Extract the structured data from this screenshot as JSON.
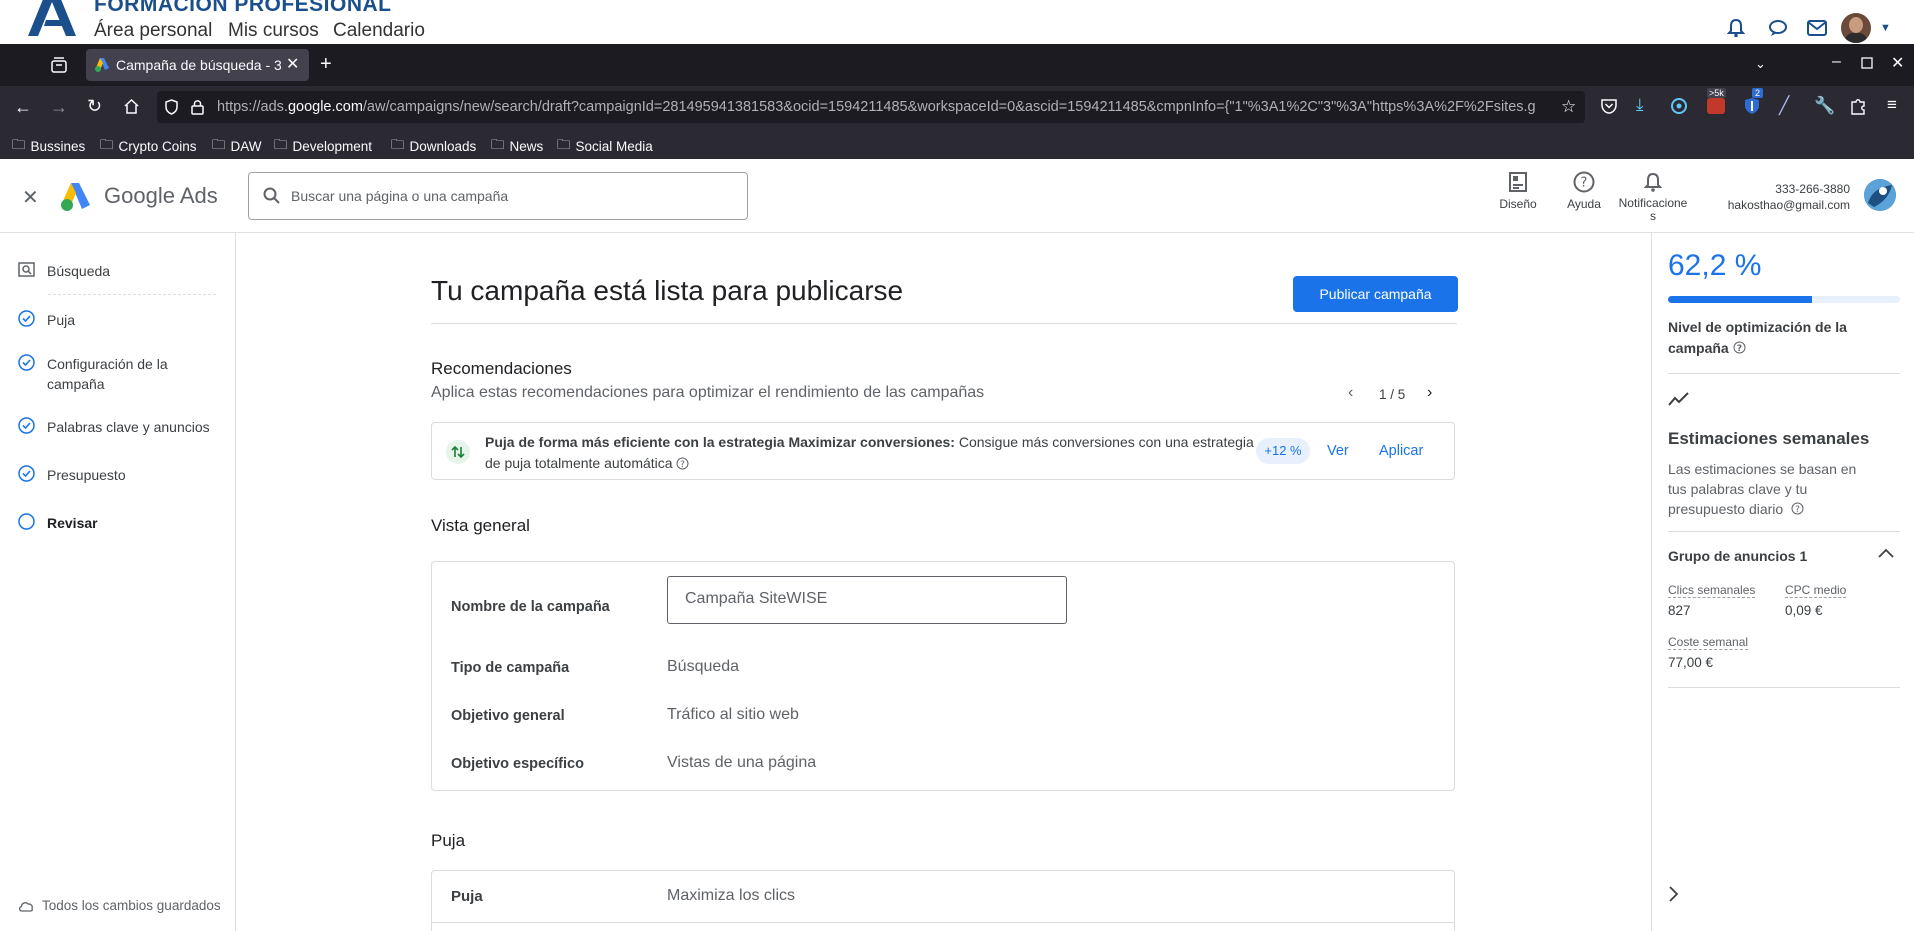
{
  "site": {
    "brand": "FORMACIÓN PROFESIONAL",
    "nav": [
      "Área personal",
      "Mis cursos",
      "Calendario"
    ]
  },
  "browser": {
    "tab_title": "Campaña de búsqueda - 3",
    "url_prefix": "https://ads.",
    "url_domain": "google.com",
    "url_rest": "/aw/campaigns/new/search/draft?campaignId=281495941381583&ocid=1594211485&workspaceId=0&ascid=1594211485&cmpnInfo={\"1\"%3A1%2C\"3\"%3A\"https%3A%2F%2Fsites.g",
    "badge_5k": ">5k",
    "badge_2": "2",
    "bookmarks": [
      "Bussines",
      "Crypto Coins",
      "DAW",
      "Development",
      "Downloads",
      "News",
      "Social Media"
    ]
  },
  "ads_header": {
    "product": "Google Ads",
    "search_placeholder": "Buscar una página o una campaña",
    "buttons": [
      {
        "label": "Diseño",
        "icon": "layout-icon"
      },
      {
        "label": "Ayuda",
        "icon": "help-icon"
      },
      {
        "label": "Notificaciones",
        "icon": "bell-icon"
      }
    ],
    "account_phone": "333-266-3880",
    "account_email": "hakosthao@gmail.com"
  },
  "leftnav": {
    "items": [
      {
        "label": "Búsqueda",
        "state": "search"
      },
      {
        "label": "Puja",
        "state": "done"
      },
      {
        "label": "Configuración de la campaña",
        "state": "done"
      },
      {
        "label": "Palabras clave y anuncios",
        "state": "done"
      },
      {
        "label": "Presupuesto",
        "state": "done"
      },
      {
        "label": "Revisar",
        "state": "current"
      }
    ],
    "saved_status": "Todos los cambios guardados"
  },
  "main": {
    "title": "Tu campaña está lista para publicarse",
    "publish_button": "Publicar campaña",
    "recommendations": {
      "heading": "Recomendaciones",
      "subheading": "Aplica estas recomendaciones para optimizar el rendimiento de las campañas",
      "pager": "1 / 5",
      "card_bold": "Puja de forma más eficiente con la estrategia Maximizar conversiones:",
      "card_text1": " Consigue más conversiones con una estrategia",
      "card_text2": "de puja totalmente automática",
      "uplift": "+12 %",
      "view": "Ver",
      "apply": "Aplicar"
    },
    "overview": {
      "heading": "Vista general",
      "campaign_name_label": "Nombre de la campaña",
      "campaign_name_value": "Campaña SiteWISE",
      "rows": [
        {
          "label": "Tipo de campaña",
          "value": "Búsqueda"
        },
        {
          "label": "Objetivo general",
          "value": "Tráfico al sitio web"
        },
        {
          "label": "Objetivo específico",
          "value": "Vistas de una página"
        }
      ]
    },
    "bidding": {
      "heading": "Puja",
      "label": "Puja",
      "value": "Maximiza los clics"
    }
  },
  "rightpanel": {
    "optimization_score": "62,2 %",
    "optimization_fraction": 0.622,
    "optimization_label": "Nivel de optimización de la campaña",
    "weekly_heading": "Estimaciones semanales",
    "weekly_desc": "Las estimaciones se basan en tus palabras clave y tu presupuesto diario",
    "ad_group": "Grupo de anuncios 1",
    "clicks_label": "Clics semanales",
    "clicks_value": "827",
    "cpc_label": "CPC medio",
    "cpc_value": "0,09 €",
    "cost_label": "Coste semanal",
    "cost_value": "77,00 €"
  },
  "colors": {
    "accent": "#1a73e8",
    "browser_dark": "#1c1b22",
    "browser_mid": "#2b2a33"
  }
}
